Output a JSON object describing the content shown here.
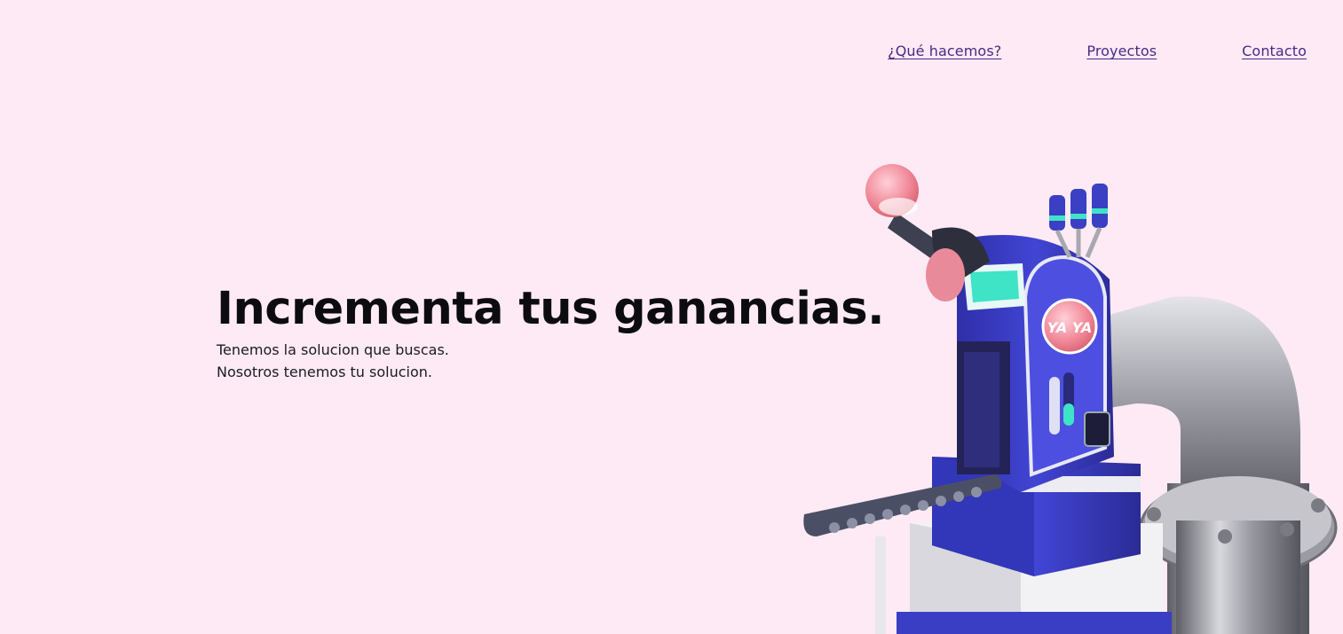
{
  "nav": {
    "items": [
      {
        "label": "¿Qué hacemos?"
      },
      {
        "label": "Proyectos"
      },
      {
        "label": "Contacto"
      }
    ]
  },
  "hero": {
    "title": "Incrementa tus ganancias.",
    "lines": [
      "Tenemos la solucion que buscas.",
      "Nosotros tenemos tu solucion."
    ]
  },
  "illustration": {
    "badge_text": "YA YA",
    "icon": "vending-machine-illustration"
  },
  "colors": {
    "background": "#fdeaf4",
    "nav_link": "#4a2a86",
    "machine_blue": "#3b3fc4",
    "accent_pink": "#f07c8e",
    "accent_teal": "#3fe3c6"
  }
}
